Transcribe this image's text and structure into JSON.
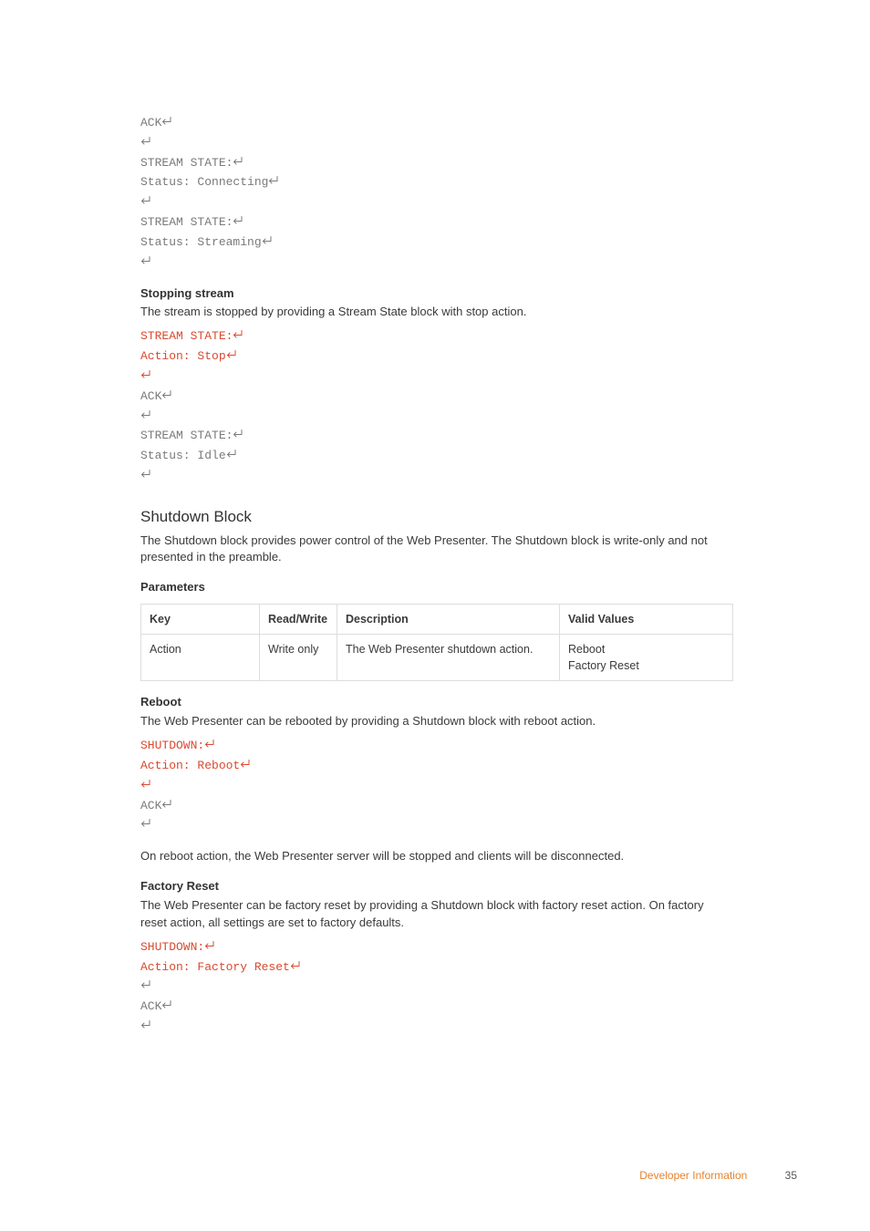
{
  "ret_glyph": "↵",
  "code1": {
    "lines": [
      {
        "cls": "code-gray",
        "text": "ACK",
        "ret": true
      },
      {
        "cls": "code-gray",
        "text": "",
        "ret": true
      },
      {
        "cls": "code-gray",
        "text": "STREAM STATE:",
        "ret": true
      },
      {
        "cls": "code-gray",
        "text": "Status: Connecting",
        "ret": true
      },
      {
        "cls": "code-gray",
        "text": "",
        "ret": true
      },
      {
        "cls": "code-gray",
        "text": "STREAM STATE:",
        "ret": true
      },
      {
        "cls": "code-gray",
        "text": "Status: Streaming",
        "ret": true
      },
      {
        "cls": "code-gray",
        "text": "",
        "ret": true
      }
    ]
  },
  "stopping": {
    "heading": "Stopping stream",
    "body": "The stream is stopped by providing a Stream State block with stop action."
  },
  "code2": {
    "lines": [
      {
        "cls": "code-red",
        "text": "STREAM STATE:",
        "ret": true
      },
      {
        "cls": "code-red",
        "text": "Action: Stop",
        "ret": true
      },
      {
        "cls": "code-red",
        "text": "",
        "ret": true
      },
      {
        "cls": "code-gray",
        "text": "ACK",
        "ret": true
      },
      {
        "cls": "code-gray",
        "text": "",
        "ret": true
      },
      {
        "cls": "code-gray",
        "text": "STREAM STATE:",
        "ret": true
      },
      {
        "cls": "code-gray",
        "text": "Status: Idle",
        "ret": true
      },
      {
        "cls": "code-gray",
        "text": "",
        "ret": true
      }
    ]
  },
  "shutdown": {
    "title": "Shutdown Block",
    "body": "The Shutdown block provides power control of the Web Presenter. The Shutdown block is write-only and not presented in the preamble."
  },
  "params": {
    "title": "Parameters",
    "headers": {
      "key": "Key",
      "rw": "Read/Write",
      "desc": "Description",
      "valid": "Valid Values"
    },
    "row": {
      "key": "Action",
      "rw": "Write only",
      "desc": "The Web Presenter shutdown action.",
      "valid1": "Reboot",
      "valid2": "Factory Reset"
    }
  },
  "reboot": {
    "heading": "Reboot",
    "body": "The Web Presenter can be rebooted by providing a Shutdown block with reboot action."
  },
  "code3": {
    "lines": [
      {
        "cls": "code-red",
        "text": "SHUTDOWN:",
        "ret": true
      },
      {
        "cls": "code-red",
        "text": "Action: Reboot",
        "ret": true
      },
      {
        "cls": "code-red",
        "text": "",
        "ret": true
      },
      {
        "cls": "code-gray",
        "text": "ACK",
        "ret": true
      },
      {
        "cls": "code-gray",
        "text": "",
        "ret": true
      }
    ]
  },
  "reboot_after": "On reboot action, the Web Presenter server will be stopped and clients will be disconnected.",
  "factory": {
    "heading": "Factory Reset",
    "body": "The Web Presenter can be factory reset by providing a Shutdown block with factory reset action. On factory reset action, all settings are set to factory defaults."
  },
  "code4": {
    "lines": [
      {
        "cls": "code-red",
        "text": "SHUTDOWN:",
        "ret": true
      },
      {
        "cls": "code-red",
        "text": "Action: Factory Reset",
        "ret": true
      },
      {
        "cls": "code-gray",
        "text": "",
        "ret": true
      },
      {
        "cls": "code-gray",
        "text": "ACK",
        "ret": true
      },
      {
        "cls": "code-gray",
        "text": "",
        "ret": true
      }
    ]
  },
  "footer": {
    "label": "Developer Information",
    "page": "35"
  }
}
